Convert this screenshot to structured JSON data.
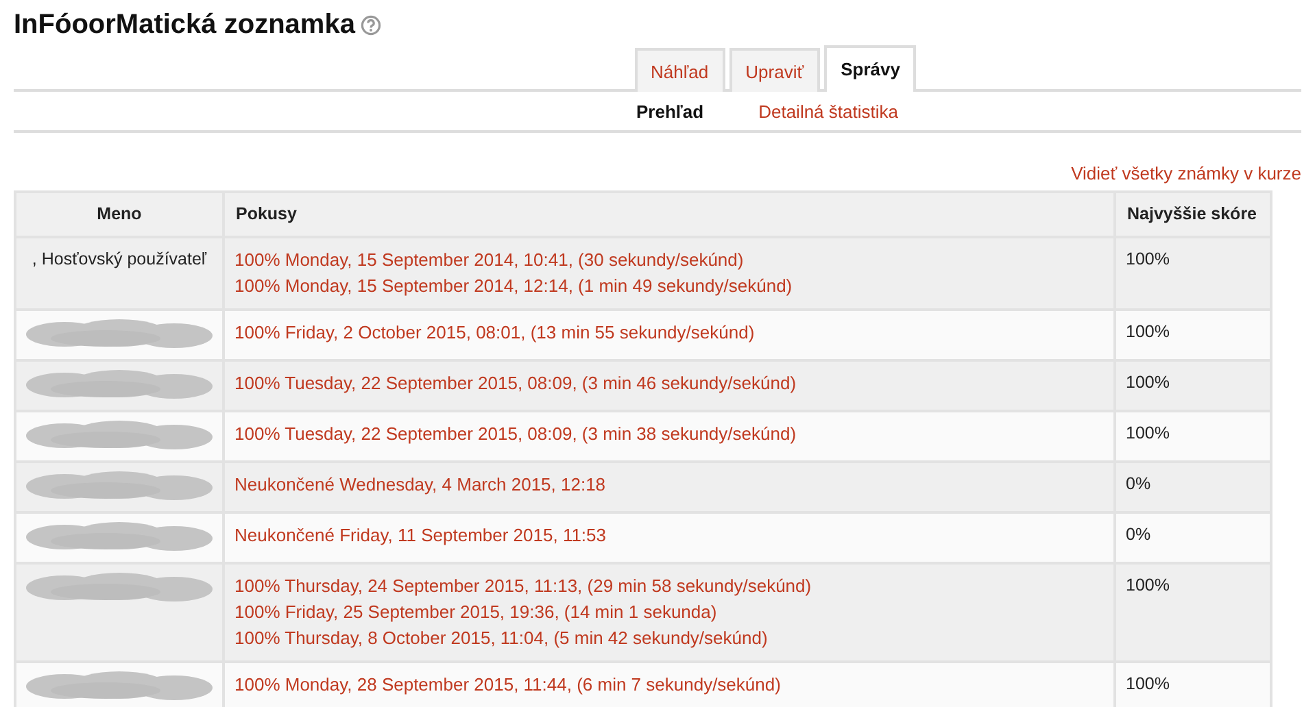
{
  "title": "InFóoorMatická zoznamka",
  "tabs": [
    {
      "label": "Náhľad",
      "selected": false
    },
    {
      "label": "Upraviť",
      "selected": false
    },
    {
      "label": "Správy",
      "selected": true
    }
  ],
  "subtabs": [
    {
      "label": "Prehľad",
      "selected": true
    },
    {
      "label": "Detailná štatistika",
      "selected": false
    }
  ],
  "grades_link": "Vidieť všetky známky v kurze",
  "table": {
    "columns": [
      "Meno",
      "Pokusy",
      "Najvyššie skóre"
    ],
    "rows": [
      {
        "kind": "named",
        "name": ", Hosťovský používateľ",
        "attempts": [
          "100% Monday, 15 September 2014, 10:41, (30 sekundy/sekúnd)",
          "100% Monday, 15 September 2014, 12:14, (1 min 49 sekundy/sekúnd)"
        ],
        "score": "100%"
      },
      {
        "kind": "redacted",
        "attempts": [
          "100% Friday, 2 October 2015, 08:01, (13 min 55 sekundy/sekúnd)"
        ],
        "score": "100%"
      },
      {
        "kind": "redacted",
        "attempts": [
          "100% Tuesday, 22 September 2015, 08:09, (3 min 46 sekundy/sekúnd)"
        ],
        "score": "100%"
      },
      {
        "kind": "redacted",
        "attempts": [
          "100% Tuesday, 22 September 2015, 08:09, (3 min 38 sekundy/sekúnd)"
        ],
        "score": "100%"
      },
      {
        "kind": "redacted",
        "attempts": [
          "Neukončené Wednesday, 4 March 2015, 12:18"
        ],
        "score": "0%"
      },
      {
        "kind": "redacted",
        "attempts": [
          "Neukončené Friday, 11 September 2015, 11:53"
        ],
        "score": "0%"
      },
      {
        "kind": "redacted",
        "attempts": [
          "100% Thursday, 24 September 2015, 11:13, (29 min 58 sekundy/sekúnd)",
          "100% Friday, 25 September 2015, 19:36, (14 min 1 sekunda)",
          "100% Thursday, 8 October 2015, 11:04, (5 min 42 sekundy/sekúnd)"
        ],
        "score": "100%"
      },
      {
        "kind": "redacted",
        "attempts": [
          "100% Monday, 28 September 2015, 11:44, (6 min 7 sekundy/sekúnd)"
        ],
        "score": "100%"
      }
    ]
  }
}
